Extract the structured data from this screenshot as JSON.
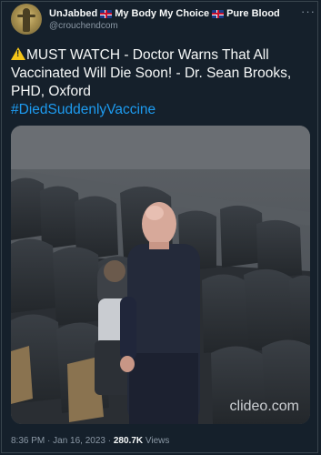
{
  "tweet": {
    "author": {
      "display_name_part1": "UnJabbed",
      "display_name_part2": "My Body My Choice",
      "display_name_part3": "Pure Blood",
      "handle": "@crouchendcom",
      "avatar_icon": "avatar-figure-icon"
    },
    "more_label": "···",
    "text": {
      "warning_icon": "warning-icon",
      "body": "MUST WATCH - Doctor Warns That All Vaccinated Will Die Soon! - Dr. Sean Brooks, PHD, Oxford",
      "hashtag": "#DiedSuddenlyVaccine"
    },
    "media": {
      "watermark": "clideo.com"
    },
    "meta": {
      "time": "8:36 PM",
      "separator1": " · ",
      "date": "Jan 16, 2023",
      "separator2": " · ",
      "views_count": "280.7K",
      "views_label": " Views"
    }
  },
  "colors": {
    "background": "#15202b",
    "text": "#f7f9f9",
    "muted": "#8b98a5",
    "link": "#1d9bf0"
  }
}
